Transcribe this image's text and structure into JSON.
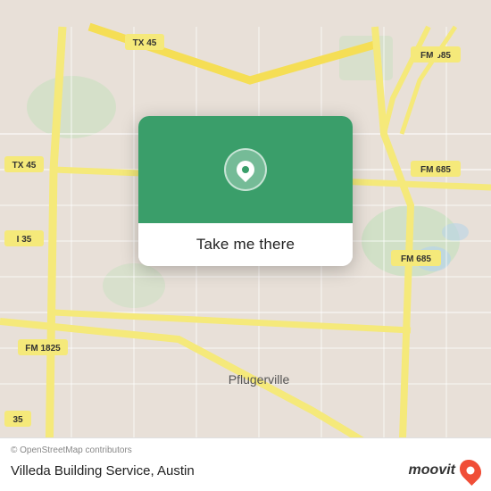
{
  "map": {
    "background_color": "#e8e0d8",
    "road_color_major": "#f5e97a",
    "road_color_minor": "#ffffff",
    "road_color_highway": "#f5e97a"
  },
  "card": {
    "background_color": "#3a9e6a",
    "button_label": "Take me there"
  },
  "bottom_bar": {
    "attribution": "© OpenStreetMap contributors",
    "place_name": "Villeda Building Service, Austin",
    "moovit_label": "moovit"
  },
  "labels": {
    "tx45_top": "TX 45",
    "tx45_left": "TX 45",
    "i35": "I 35",
    "fm1825": "FM 1825",
    "fm685_top": "FM 685",
    "fm685_mid": "FM 685",
    "fm685_bot": "FM 685",
    "pflugerville": "Pflugerville",
    "highway35_bot": "35"
  }
}
